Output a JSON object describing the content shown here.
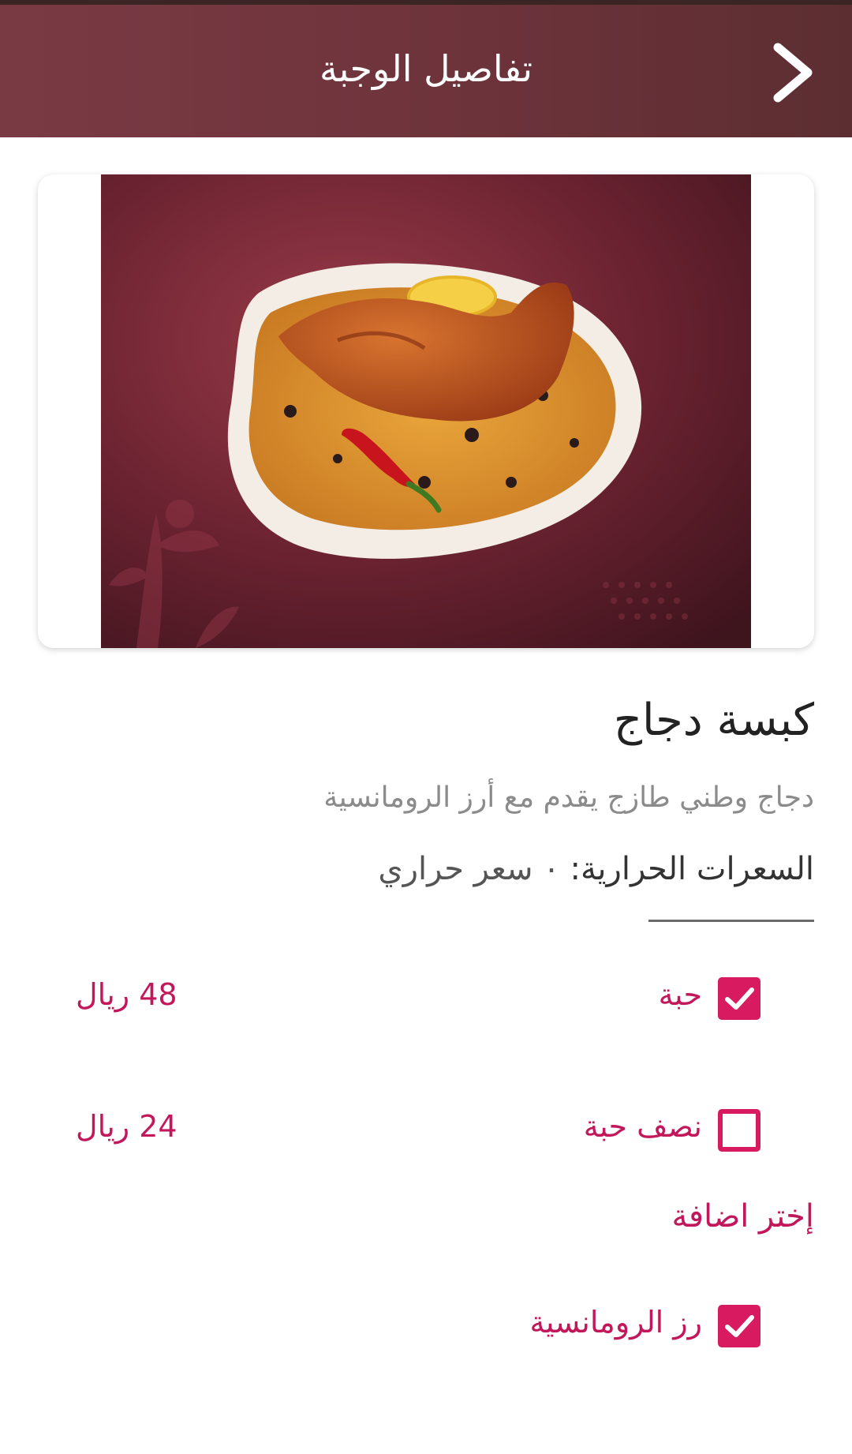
{
  "header": {
    "title": "تفاصيل الوجبة",
    "back_icon": "chevron-right-icon"
  },
  "meal": {
    "image_alt": "كبسة دجاج",
    "name": "كبسة دجاج",
    "description": "دجاج وطني طازج يقدم مع أرز الرومانسية",
    "calories_label": "السعرات الحرارية:",
    "calories_value": "٠ سعر حراري"
  },
  "sizes": [
    {
      "label": "حبة",
      "price": "48 ريال",
      "checked": true
    },
    {
      "label": "نصف حبة",
      "price": "24 ريال",
      "checked": false
    }
  ],
  "addons": {
    "title": "إختر اضافة",
    "items": [
      {
        "label": "رز الرومانسية",
        "checked": true
      }
    ]
  },
  "colors": {
    "header": "#6d333b",
    "accent": "#d81b60",
    "text_accent": "#c2185b"
  }
}
